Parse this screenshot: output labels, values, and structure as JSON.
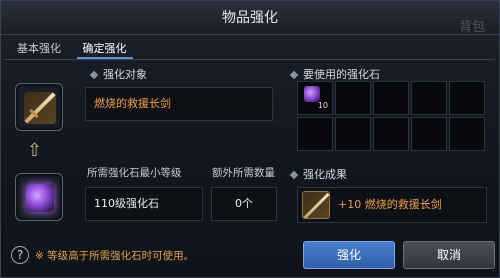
{
  "window": {
    "title": "物品强化",
    "bg_text": "背包"
  },
  "tabs": [
    {
      "label": "基本强化",
      "active": false
    },
    {
      "label": "确定强化",
      "active": true
    }
  ],
  "left": {
    "target_title": "强化对象",
    "target_item_name": "燃烧的救援长剑",
    "min_level_label": "所需强化石最小等级",
    "min_level_value": "110级强化石",
    "extra_count_label": "额外所需数量",
    "extra_count_value": "0个"
  },
  "right": {
    "stones_title": "要使用的强化石",
    "stone_grid": [
      {
        "filled": true,
        "qty": "10"
      },
      {
        "filled": false,
        "qty": ""
      },
      {
        "filled": false,
        "qty": ""
      },
      {
        "filled": false,
        "qty": ""
      },
      {
        "filled": false,
        "qty": ""
      },
      {
        "filled": false,
        "qty": ""
      },
      {
        "filled": false,
        "qty": ""
      },
      {
        "filled": false,
        "qty": ""
      },
      {
        "filled": false,
        "qty": ""
      },
      {
        "filled": false,
        "qty": ""
      }
    ],
    "result_title": "强化成果",
    "result_text": "+10 燃烧的救援长剑"
  },
  "footer": {
    "help_symbol": "?",
    "notice": "※ 等级高于所需强化石时可使用。",
    "confirm_label": "强化",
    "cancel_label": "取消"
  },
  "colors": {
    "accent": "#3d6fbf",
    "item_orange": "#f0a04b"
  }
}
